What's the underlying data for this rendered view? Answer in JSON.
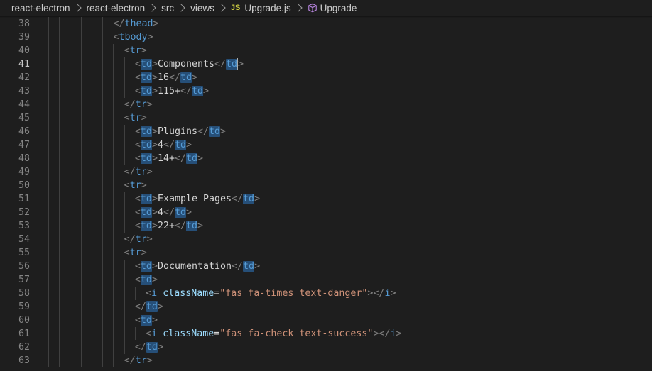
{
  "breadcrumb": {
    "items": [
      "react-electron",
      "react-electron",
      "src",
      "views"
    ],
    "file_badge": "JS",
    "file": "Upgrade.js",
    "symbol": "Upgrade"
  },
  "colors": {
    "background": "#1e1e1e",
    "bracket": "#808080",
    "tag": "#569cd6",
    "text": "#d4d4d4",
    "attribute": "#9cdcfe",
    "string": "#ce9178",
    "match_highlight": "#264f78"
  },
  "editor": {
    "active_line": "41",
    "lines": [
      {
        "num": "38",
        "indent": 12,
        "tokens": [
          [
            "br",
            "</"
          ],
          [
            "tag",
            "thead"
          ],
          [
            "br",
            ">"
          ]
        ]
      },
      {
        "num": "39",
        "indent": 12,
        "tokens": [
          [
            "br",
            "<"
          ],
          [
            "tag",
            "tbody"
          ],
          [
            "br",
            ">"
          ]
        ]
      },
      {
        "num": "40",
        "indent": 14,
        "tokens": [
          [
            "br",
            "<"
          ],
          [
            "tag",
            "tr"
          ],
          [
            "br",
            ">"
          ]
        ]
      },
      {
        "num": "41",
        "indent": 16,
        "tokens": [
          [
            "br",
            "<"
          ],
          [
            "tagh",
            "td"
          ],
          [
            "br",
            ">"
          ],
          [
            "text",
            "Components"
          ],
          [
            "br",
            "</"
          ],
          [
            "tagh",
            "td"
          ],
          [
            "br",
            ">"
          ]
        ]
      },
      {
        "num": "42",
        "indent": 16,
        "tokens": [
          [
            "br",
            "<"
          ],
          [
            "tagh",
            "td"
          ],
          [
            "br",
            ">"
          ],
          [
            "text",
            "16"
          ],
          [
            "br",
            "</"
          ],
          [
            "tagh",
            "td"
          ],
          [
            "br",
            ">"
          ]
        ]
      },
      {
        "num": "43",
        "indent": 16,
        "tokens": [
          [
            "br",
            "<"
          ],
          [
            "tagh",
            "td"
          ],
          [
            "br",
            ">"
          ],
          [
            "text",
            "115+"
          ],
          [
            "br",
            "</"
          ],
          [
            "tagh",
            "td"
          ],
          [
            "br",
            ">"
          ]
        ]
      },
      {
        "num": "44",
        "indent": 14,
        "tokens": [
          [
            "br",
            "</"
          ],
          [
            "tag",
            "tr"
          ],
          [
            "br",
            ">"
          ]
        ]
      },
      {
        "num": "45",
        "indent": 14,
        "tokens": [
          [
            "br",
            "<"
          ],
          [
            "tag",
            "tr"
          ],
          [
            "br",
            ">"
          ]
        ]
      },
      {
        "num": "46",
        "indent": 16,
        "tokens": [
          [
            "br",
            "<"
          ],
          [
            "tagh",
            "td"
          ],
          [
            "br",
            ">"
          ],
          [
            "text",
            "Plugins"
          ],
          [
            "br",
            "</"
          ],
          [
            "tagh",
            "td"
          ],
          [
            "br",
            ">"
          ]
        ]
      },
      {
        "num": "47",
        "indent": 16,
        "tokens": [
          [
            "br",
            "<"
          ],
          [
            "tagh",
            "td"
          ],
          [
            "br",
            ">"
          ],
          [
            "text",
            "4"
          ],
          [
            "br",
            "</"
          ],
          [
            "tagh",
            "td"
          ],
          [
            "br",
            ">"
          ]
        ]
      },
      {
        "num": "48",
        "indent": 16,
        "tokens": [
          [
            "br",
            "<"
          ],
          [
            "tagh",
            "td"
          ],
          [
            "br",
            ">"
          ],
          [
            "text",
            "14+"
          ],
          [
            "br",
            "</"
          ],
          [
            "tagh",
            "td"
          ],
          [
            "br",
            ">"
          ]
        ]
      },
      {
        "num": "49",
        "indent": 14,
        "tokens": [
          [
            "br",
            "</"
          ],
          [
            "tag",
            "tr"
          ],
          [
            "br",
            ">"
          ]
        ]
      },
      {
        "num": "50",
        "indent": 14,
        "tokens": [
          [
            "br",
            "<"
          ],
          [
            "tag",
            "tr"
          ],
          [
            "br",
            ">"
          ]
        ]
      },
      {
        "num": "51",
        "indent": 16,
        "tokens": [
          [
            "br",
            "<"
          ],
          [
            "tagh",
            "td"
          ],
          [
            "br",
            ">"
          ],
          [
            "text",
            "Example Pages"
          ],
          [
            "br",
            "</"
          ],
          [
            "tagh",
            "td"
          ],
          [
            "br",
            ">"
          ]
        ]
      },
      {
        "num": "52",
        "indent": 16,
        "tokens": [
          [
            "br",
            "<"
          ],
          [
            "tagh",
            "td"
          ],
          [
            "br",
            ">"
          ],
          [
            "text",
            "4"
          ],
          [
            "br",
            "</"
          ],
          [
            "tagh",
            "td"
          ],
          [
            "br",
            ">"
          ]
        ]
      },
      {
        "num": "53",
        "indent": 16,
        "tokens": [
          [
            "br",
            "<"
          ],
          [
            "tagh",
            "td"
          ],
          [
            "br",
            ">"
          ],
          [
            "text",
            "22+"
          ],
          [
            "br",
            "</"
          ],
          [
            "tagh",
            "td"
          ],
          [
            "br",
            ">"
          ]
        ]
      },
      {
        "num": "54",
        "indent": 14,
        "tokens": [
          [
            "br",
            "</"
          ],
          [
            "tag",
            "tr"
          ],
          [
            "br",
            ">"
          ]
        ]
      },
      {
        "num": "55",
        "indent": 14,
        "tokens": [
          [
            "br",
            "<"
          ],
          [
            "tag",
            "tr"
          ],
          [
            "br",
            ">"
          ]
        ]
      },
      {
        "num": "56",
        "indent": 16,
        "tokens": [
          [
            "br",
            "<"
          ],
          [
            "tagh",
            "td"
          ],
          [
            "br",
            ">"
          ],
          [
            "text",
            "Documentation"
          ],
          [
            "br",
            "</"
          ],
          [
            "tagh",
            "td"
          ],
          [
            "br",
            ">"
          ]
        ]
      },
      {
        "num": "57",
        "indent": 16,
        "tokens": [
          [
            "br",
            "<"
          ],
          [
            "tagh",
            "td"
          ],
          [
            "br",
            ">"
          ]
        ]
      },
      {
        "num": "58",
        "indent": 18,
        "tokens": [
          [
            "br",
            "<"
          ],
          [
            "tag",
            "i"
          ],
          [
            "text",
            " "
          ],
          [
            "attr",
            "className"
          ],
          [
            "text",
            "="
          ],
          [
            "str",
            "\"fas fa-times text-danger\""
          ],
          [
            "br",
            "></"
          ],
          [
            "tag",
            "i"
          ],
          [
            "br",
            ">"
          ]
        ]
      },
      {
        "num": "59",
        "indent": 16,
        "tokens": [
          [
            "br",
            "</"
          ],
          [
            "tagh",
            "td"
          ],
          [
            "br",
            ">"
          ]
        ]
      },
      {
        "num": "60",
        "indent": 16,
        "tokens": [
          [
            "br",
            "<"
          ],
          [
            "tagh",
            "td"
          ],
          [
            "br",
            ">"
          ]
        ]
      },
      {
        "num": "61",
        "indent": 18,
        "tokens": [
          [
            "br",
            "<"
          ],
          [
            "tag",
            "i"
          ],
          [
            "text",
            " "
          ],
          [
            "attr",
            "className"
          ],
          [
            "text",
            "="
          ],
          [
            "str",
            "\"fas fa-check text-success\""
          ],
          [
            "br",
            "></"
          ],
          [
            "tag",
            "i"
          ],
          [
            "br",
            ">"
          ]
        ]
      },
      {
        "num": "62",
        "indent": 16,
        "tokens": [
          [
            "br",
            "</"
          ],
          [
            "tagh",
            "td"
          ],
          [
            "br",
            ">"
          ]
        ]
      },
      {
        "num": "63",
        "indent": 14,
        "tokens": [
          [
            "br",
            "</"
          ],
          [
            "tag",
            "tr"
          ],
          [
            "br",
            ">"
          ]
        ]
      }
    ]
  }
}
